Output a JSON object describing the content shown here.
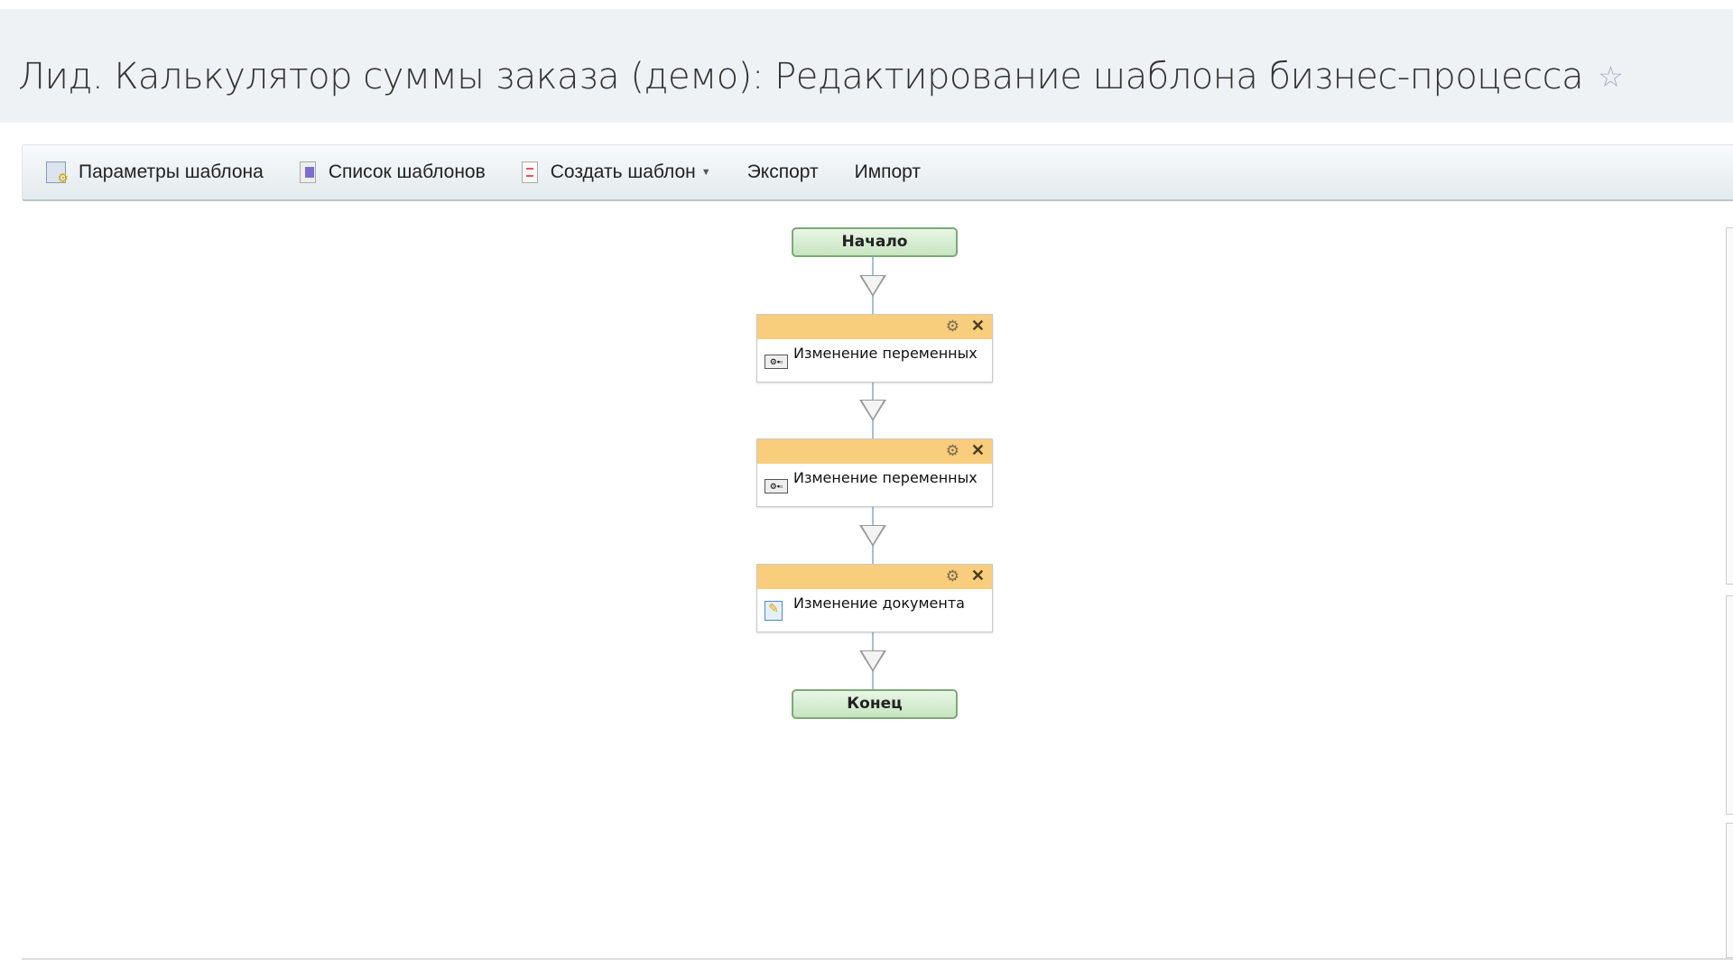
{
  "header": {
    "title": "Лид. Калькулятор суммы заказа (демо): Редактирование шаблона бизнес-процесса",
    "favorite_icon": "star-icon"
  },
  "toolbar": {
    "items": [
      {
        "label": "Параметры шаблона",
        "icon": "template-settings-icon"
      },
      {
        "label": "Список шаблонов",
        "icon": "template-list-icon"
      },
      {
        "label": "Создать шаблон",
        "icon": "create-template-icon"
      },
      {
        "label": "Экспорт"
      },
      {
        "label": "Импорт"
      }
    ]
  },
  "flow": {
    "start": "Начало",
    "end": "Конец",
    "activities": [
      {
        "label": "Изменение переменных",
        "icon": "variables-icon"
      },
      {
        "label": "Изменение переменных",
        "icon": "variables-icon"
      },
      {
        "label": "Изменение документа",
        "icon": "edit-document-icon"
      }
    ]
  }
}
